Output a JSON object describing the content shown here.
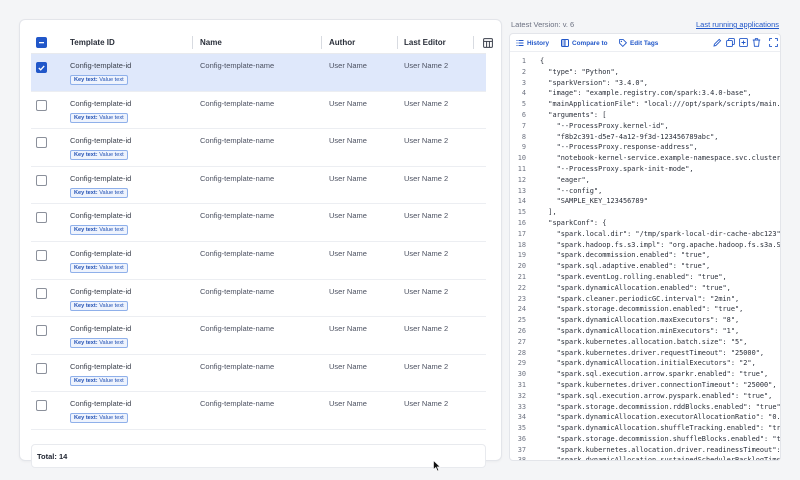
{
  "table": {
    "columns": [
      "Template ID",
      "Name",
      "Author",
      "Last Editor"
    ],
    "rows": [
      {
        "id": "Config-template-id",
        "name": "Config-template-name",
        "author": "User Name",
        "editor": "User Name 2",
        "tag_key": "Key text:",
        "tag_value": "Value text",
        "selected": true
      },
      {
        "id": "Config-template-id",
        "name": "Config-template-name",
        "author": "User Name",
        "editor": "User Name 2",
        "tag_key": "Key text:",
        "tag_value": "Value text",
        "selected": false
      },
      {
        "id": "Config-template-id",
        "name": "Config-template-name",
        "author": "User Name",
        "editor": "User Name 2",
        "tag_key": "Key text:",
        "tag_value": "Value text",
        "selected": false
      },
      {
        "id": "Config-template-id",
        "name": "Config-template-name",
        "author": "User Name",
        "editor": "User Name 2",
        "tag_key": "Key text:",
        "tag_value": "Value text",
        "selected": false
      },
      {
        "id": "Config-template-id",
        "name": "Config-template-name",
        "author": "User Name",
        "editor": "User Name 2",
        "tag_key": "Key text:",
        "tag_value": "Value text",
        "selected": false
      },
      {
        "id": "Config-template-id",
        "name": "Config-template-name",
        "author": "User Name",
        "editor": "User Name 2",
        "tag_key": "Key text:",
        "tag_value": "Value text",
        "selected": false
      },
      {
        "id": "Config-template-id",
        "name": "Config-template-name",
        "author": "User Name",
        "editor": "User Name 2",
        "tag_key": "Key text:",
        "tag_value": "Value text",
        "selected": false
      },
      {
        "id": "Config-template-id",
        "name": "Config-template-name",
        "author": "User Name",
        "editor": "User Name 2",
        "tag_key": "Key text:",
        "tag_value": "Value text",
        "selected": false
      },
      {
        "id": "Config-template-id",
        "name": "Config-template-name",
        "author": "User Name",
        "editor": "User Name 2",
        "tag_key": "Key text:",
        "tag_value": "Value text",
        "selected": false
      },
      {
        "id": "Config-template-id",
        "name": "Config-template-name",
        "author": "User Name",
        "editor": "User Name 2",
        "tag_key": "Key text:",
        "tag_value": "Value text",
        "selected": false
      }
    ],
    "total": "Total: 14"
  },
  "version": {
    "label": "Latest Version:  v. 6",
    "last_running": "Last running applications"
  },
  "toolbar": {
    "history": "History",
    "compare": "Compare to",
    "edit_tags": "Edit Tags"
  },
  "code_lines": [
    "{",
    "  \"type\": \"Python\",",
    "  \"sparkVersion\": \"3.4.0\",",
    "  \"image\": \"example.registry.com/spark:3.4.0-base\",",
    "  \"mainApplicationFile\": \"local:///opt/spark/scripts/main.py\",",
    "  \"arguments\": [",
    "    \"--ProcessProxy.kernel-id\",",
    "    \"f8b2c391-d5e7-4a12-9f3d-123456789abc\",",
    "    \"--ProcessProxy.response-address\",",
    "    \"notebook-kernel-service.example-namespace.svc.cluster.loc",
    "    \"--ProcessProxy.spark-init-mode\",",
    "    \"eager\",",
    "    \"--config\",",
    "    \"SAMPLE_KEY_123456789\"",
    "  ],",
    "  \"sparkConf\": {",
    "    \"spark.local.dir\": \"/tmp/spark-local-dir-cache-abc123\",",
    "    \"spark.hadoop.fs.s3.impl\": \"org.apache.hadoop.fs.s3a.S3AFi",
    "    \"spark.decommission.enabled\": \"true\",",
    "    \"spark.sql.adaptive.enabled\": \"true\",",
    "    \"spark.eventLog.rolling.enabled\": \"true\",",
    "    \"spark.dynamicAllocation.enabled\": \"true\",",
    "    \"spark.cleaner.periodicGC.interval\": \"2min\",",
    "    \"spark.storage.decommission.enabled\": \"true\",",
    "    \"spark.dynamicAllocation.maxExecutors\": \"8\",",
    "    \"spark.dynamicAllocation.minExecutors\": \"1\",",
    "    \"spark.kubernetes.allocation.batch.size\": \"5\",",
    "    \"spark.kubernetes.driver.requestTimeout\": \"25000\",",
    "    \"spark.dynamicAllocation.initialExecutors\": \"2\",",
    "    \"spark.sql.execution.arrow.sparkr.enabled\": \"true\",",
    "    \"spark.kubernetes.driver.connectionTimeout\": \"25000\",",
    "    \"spark.sql.execution.arrow.pyspark.enabled\": \"true\",",
    "    \"spark.storage.decommission.rddBlocks.enabled\": \"true\",",
    "    \"spark.dynamicAllocation.executorAllocationRatio\": \"0.5\",",
    "    \"spark.dynamicAllocation.shuffleTracking.enabled\": \"true\",",
    "    \"spark.storage.decommission.shuffleBlocks.enabled\": \"true\"",
    "    \"spark.kubernetes.allocation.driver.readinessTimeout\": \"90",
    "    \"spark.dynamicAllocation.sustainedSchedulerBacklogTimeout\""
  ],
  "colors": {
    "accent": "#2157c9",
    "selected_row": "#dfe8fb",
    "tag_bg": "#eef3fd"
  },
  "icons": [
    "table-settings-icon",
    "history-icon",
    "compare-icon",
    "tag-icon",
    "edit-icon",
    "copy-icon",
    "duplicate-icon",
    "delete-icon",
    "fullscreen-icon"
  ]
}
